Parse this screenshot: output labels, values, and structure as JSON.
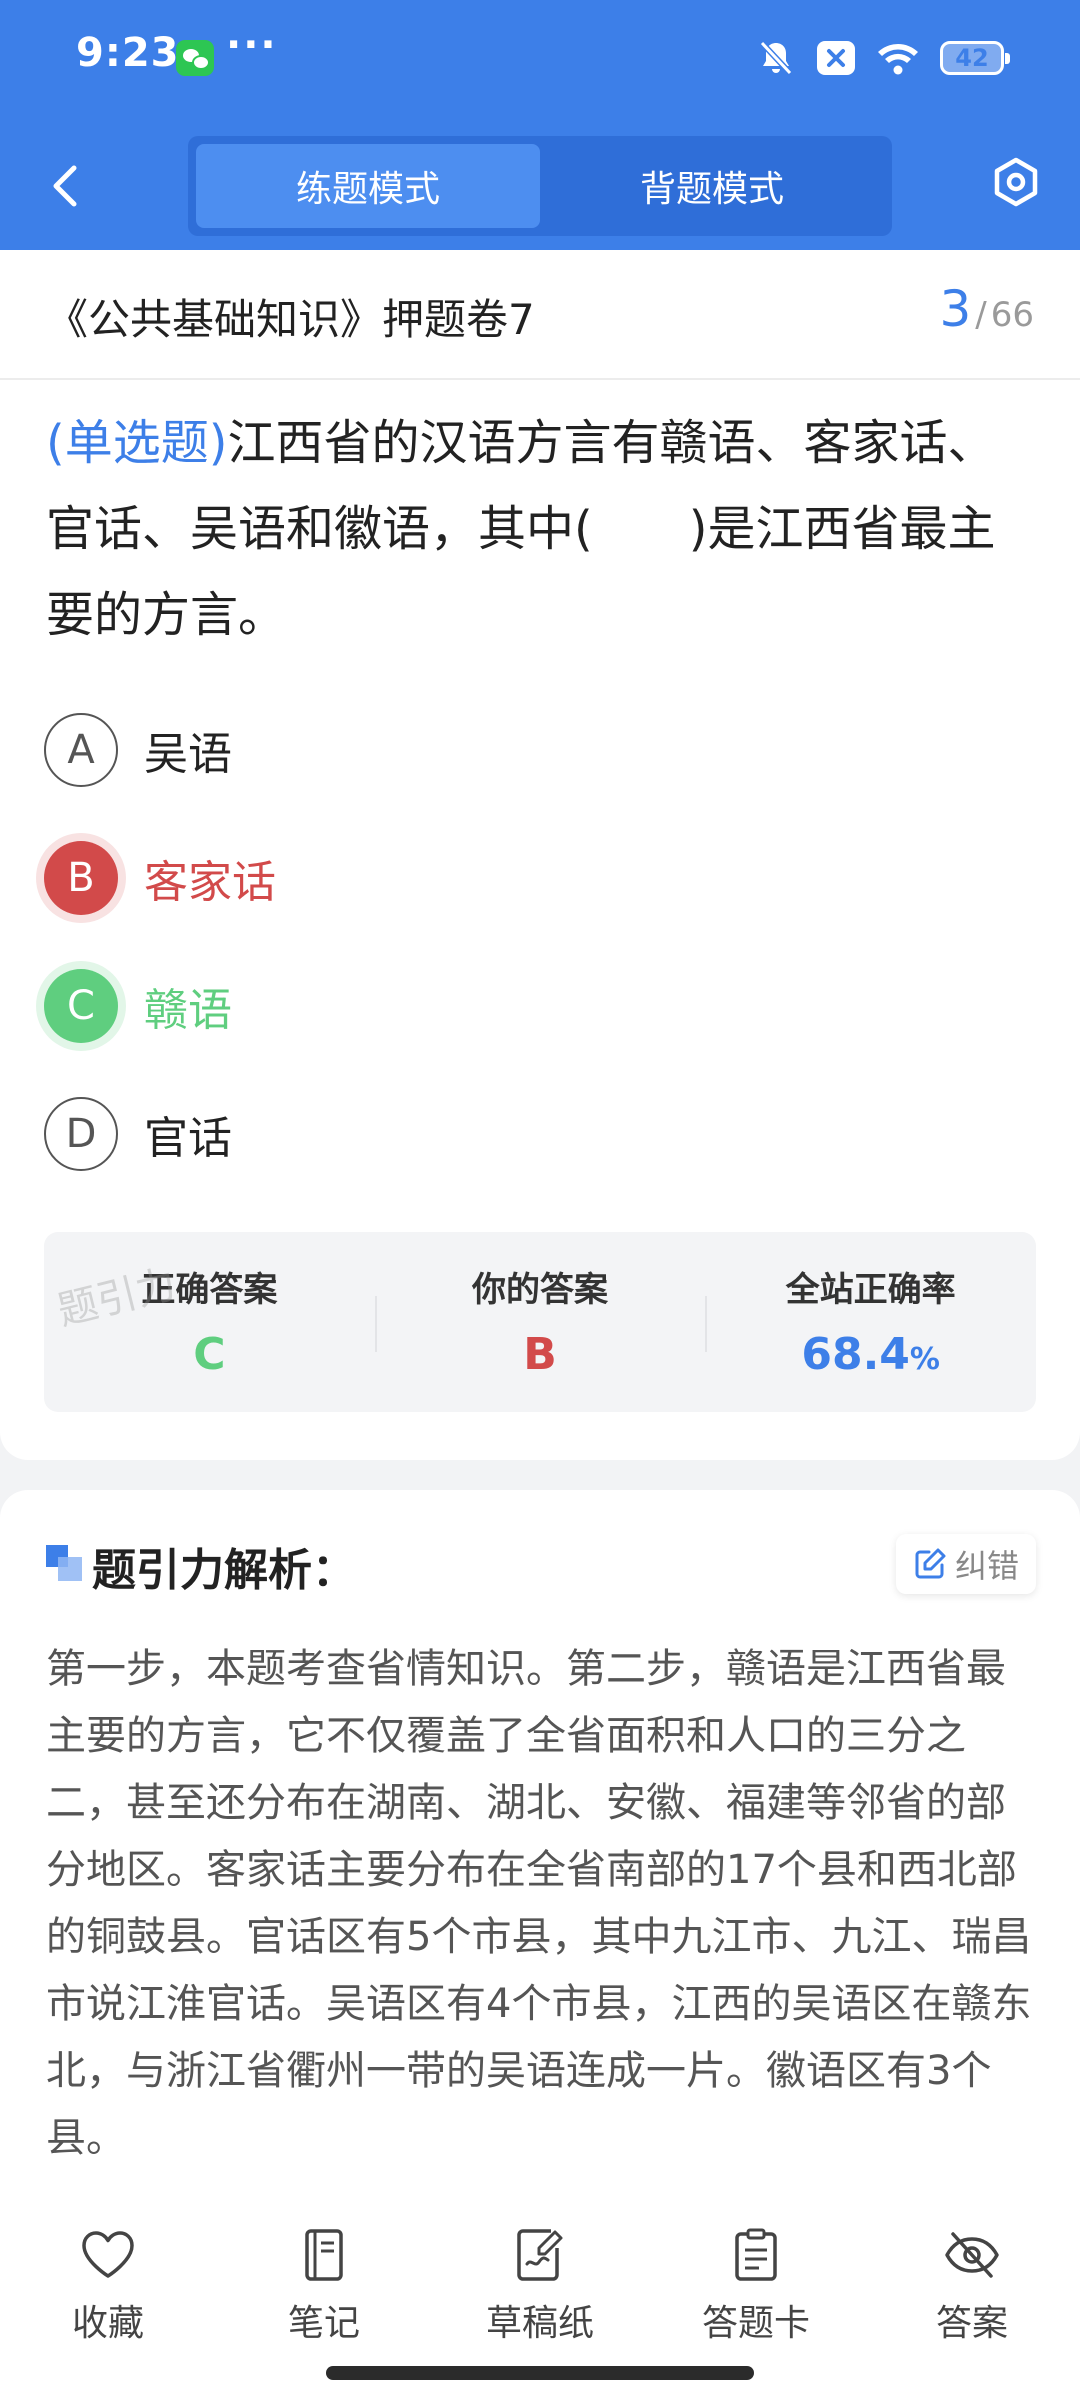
{
  "status_bar": {
    "time": "9:23",
    "more": "···",
    "battery": "42",
    "icons": [
      "wechat-icon",
      "bell-mute-icon",
      "close-box-icon",
      "wifi-icon",
      "battery-icon"
    ]
  },
  "header": {
    "tabs": [
      {
        "label": "练题模式",
        "active": true
      },
      {
        "label": "背题模式",
        "active": false
      }
    ]
  },
  "paper": {
    "title": "《公共基础知识》押题卷7",
    "current": "3",
    "separator": "/",
    "total": "66"
  },
  "question": {
    "type": "(单选题)",
    "text": "江西省的汉语方言有赣语、客家话、官话、吴语和徽语，其中(　　)是江西省最主要的方言。"
  },
  "options": [
    {
      "letter": "A",
      "text": "吴语",
      "state": "normal"
    },
    {
      "letter": "B",
      "text": "客家话",
      "state": "wrong"
    },
    {
      "letter": "C",
      "text": "赣语",
      "state": "correct"
    },
    {
      "letter": "D",
      "text": "官话",
      "state": "normal"
    }
  ],
  "answer_summary": {
    "correct_label": "正确答案",
    "correct_value": "C",
    "yours_label": "你的答案",
    "yours_value": "B",
    "rate_label": "全站正确率",
    "rate_value": "68.4",
    "rate_unit": "%"
  },
  "watermark": "题引力",
  "analysis": {
    "title": "题引力解析：",
    "correct_button": "纠错",
    "text": "第一步，本题考查省情知识。第二步，赣语是江西省最主要的方言，它不仅覆盖了全省面积和人口的三分之二，甚至还分布在湖南、湖北、安徽、福建等邻省的部分地区。客家话主要分布在全省南部的17个县和西北部的铜鼓县。官话区有5个市县，其中九江市、九江、瑞昌市说江淮官话。吴语区有4个市县，江西的吴语区在赣东北，与浙江省衢州一带的吴语连成一片。徽语区有3个县。"
  },
  "bottom_tabs": [
    {
      "label": "收藏",
      "icon": "heart-icon"
    },
    {
      "label": "笔记",
      "icon": "notebook-icon"
    },
    {
      "label": "草稿纸",
      "icon": "draft-icon"
    },
    {
      "label": "答题卡",
      "icon": "answer-card-icon"
    },
    {
      "label": "答案",
      "icon": "eye-off-icon"
    }
  ],
  "colors": {
    "primary": "#3d7fe8",
    "wrong": "#d24a4a",
    "correct": "#5fce7f"
  }
}
